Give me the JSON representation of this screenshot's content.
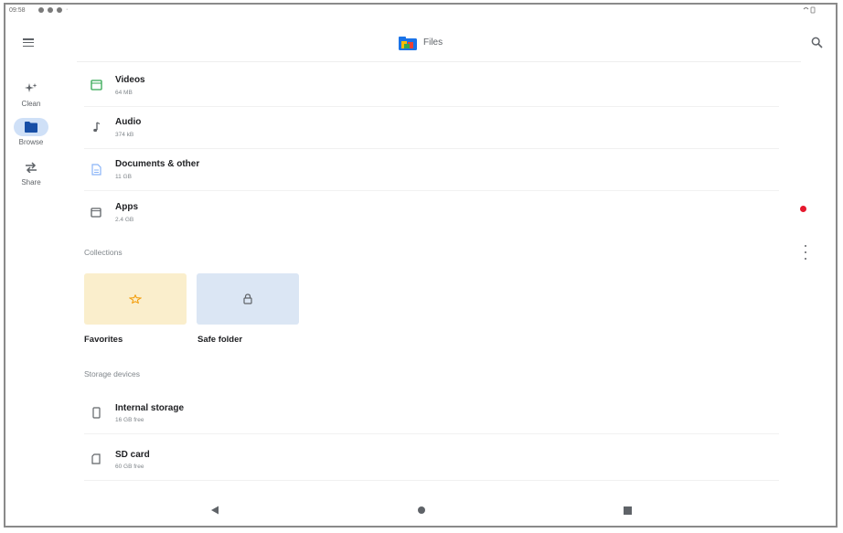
{
  "status_bar": {
    "time": "09:58"
  },
  "app_bar": {
    "title": "Files"
  },
  "nav_rail": {
    "items": [
      {
        "label": "Clean"
      },
      {
        "label": "Browse"
      },
      {
        "label": "Share"
      }
    ]
  },
  "categories": [
    {
      "title": "Videos",
      "subtitle": "64 MB"
    },
    {
      "title": "Audio",
      "subtitle": "374 kB"
    },
    {
      "title": "Documents & other",
      "subtitle": "11 GB"
    },
    {
      "title": "Apps",
      "subtitle": "2.4 GB"
    }
  ],
  "collections": {
    "header": "Collections",
    "items": [
      {
        "label": "Favorites"
      },
      {
        "label": "Safe folder"
      }
    ]
  },
  "storage": {
    "header": "Storage devices",
    "items": [
      {
        "title": "Internal storage",
        "subtitle": "16 GB free"
      },
      {
        "title": "SD card",
        "subtitle": "60 GB free"
      }
    ]
  },
  "colors": {
    "accent": "#1a73e8",
    "favorites_bg": "#faeecc",
    "safe_folder_bg": "#dbe6f4",
    "notification_dot": "#e5182d"
  }
}
